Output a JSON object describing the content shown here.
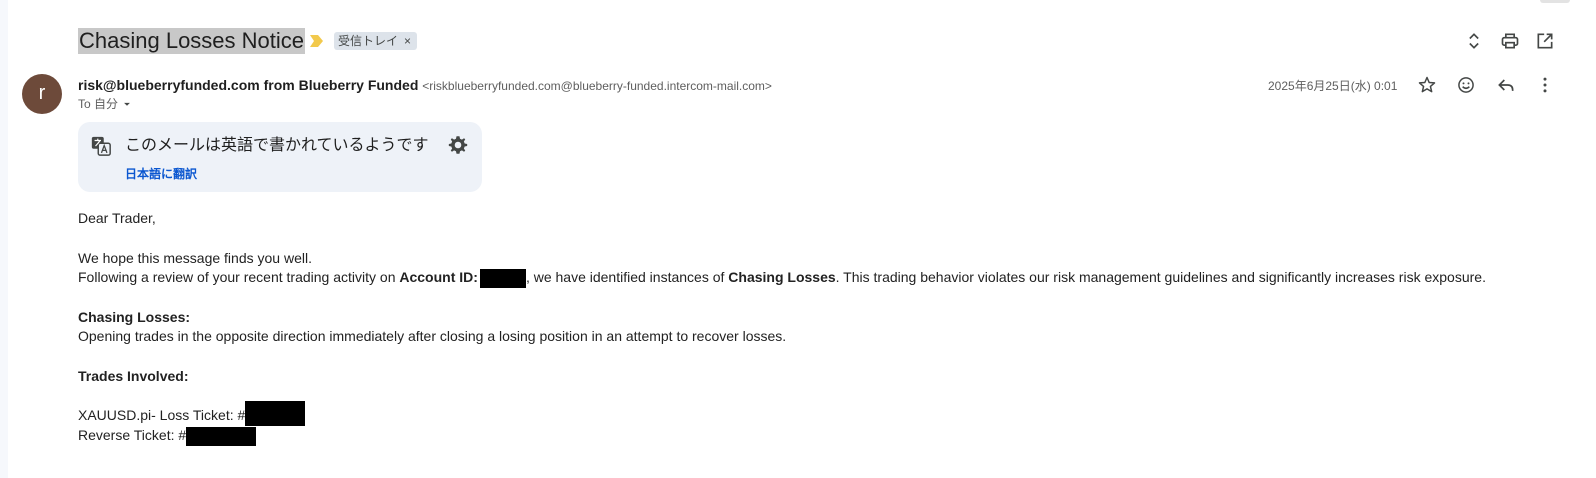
{
  "subject": "Chasing Losses Notice",
  "label_chip": {
    "text": "受信トレイ",
    "remove": "×"
  },
  "header_actions": [
    "expand-collapse-icon",
    "print-icon",
    "open-new-window-icon"
  ],
  "message": {
    "avatar_letter": "r",
    "sender_name": "risk@blueberryfunded.com from Blueberry Funded",
    "sender_address": "<riskblueberryfunded.com@blueberry-funded.intercom-mail.com>",
    "to_label": "To 自分",
    "date": "2025年6月25日(水) 0:01",
    "actions": [
      "star-icon",
      "emoji-reaction-icon",
      "reply-icon",
      "more-vert-icon"
    ]
  },
  "translate": {
    "title": "このメールは英語で書かれているようです",
    "link": "日本語に翻訳"
  },
  "body": {
    "greeting": "Dear Trader,",
    "line1": "We hope this message finds you well.",
    "line2_a": "Following a review of your recent trading activity on ",
    "line2_b": "Account ID:",
    "line2_c": ", we have identified instances of ",
    "line2_d": "Chasing Losses",
    "line2_e": ". This trading behavior violates our risk management guidelines and significantly increases risk exposure.",
    "chasing_heading": "Chasing Losses:",
    "chasing_desc": "Opening trades in the opposite direction immediately after closing a losing position in an attempt to recover losses.",
    "trades_heading": "Trades Involved:",
    "trade1": "XAUUSD.pi- Loss Ticket: #",
    "trade2": "Reverse Ticket: #"
  },
  "colors": {
    "avatar": "#6d4a3a",
    "link": "#0b57d0",
    "importance": "#f2c94c",
    "translate_bg": "#eef2f8"
  }
}
